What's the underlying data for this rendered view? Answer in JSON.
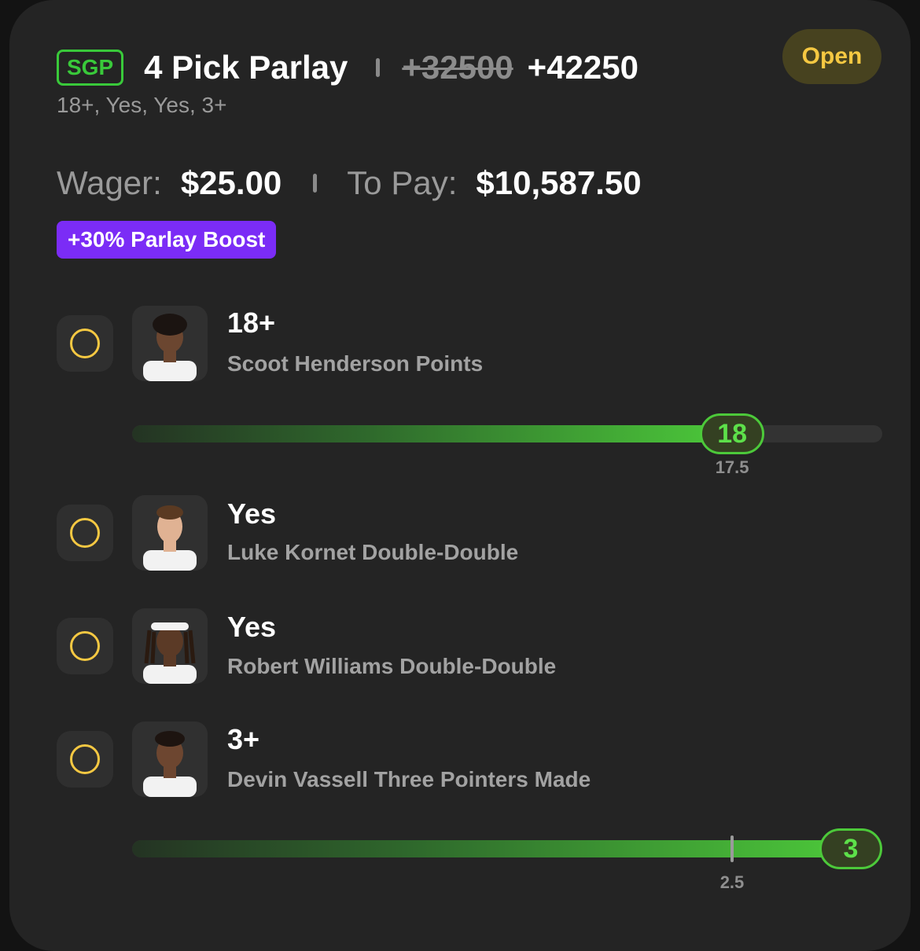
{
  "parlay": {
    "badge": "SGP",
    "title": "4 Pick Parlay",
    "old_odds": "+32500",
    "new_odds": "+42250",
    "selections_summary": "18+, Yes, Yes, 3+",
    "status": "Open"
  },
  "wager": {
    "wager_label": "Wager:",
    "wager_amount": "$25.00",
    "payout_label": "To Pay:",
    "payout_amount": "$10,587.50"
  },
  "boost": {
    "label": "+30% Parlay Boost"
  },
  "legs": [
    {
      "selection": "18+",
      "market": "Scoot Henderson Points",
      "avatar_icon": "player-headshot-icon",
      "progress": {
        "current": "18",
        "line": "17.5",
        "fill_fraction": 0.8,
        "line_fraction": 0.8
      }
    },
    {
      "selection": "Yes",
      "market": "Luke Kornet Double-Double",
      "avatar_icon": "player-headshot-icon"
    },
    {
      "selection": "Yes",
      "market": "Robert Williams Double-Double",
      "avatar_icon": "player-headshot-icon"
    },
    {
      "selection": "3+",
      "market": "Devin Vassell Three Pointers Made",
      "avatar_icon": "player-headshot-icon",
      "progress": {
        "current": "3",
        "line": "2.5",
        "fill_fraction": 0.96,
        "line_fraction": 0.8
      }
    }
  ],
  "colors": {
    "card_bg": "#242424",
    "accent_green": "#39c93a",
    "status_yellow": "#f5c842",
    "boost_purple": "#7b2cf6"
  }
}
